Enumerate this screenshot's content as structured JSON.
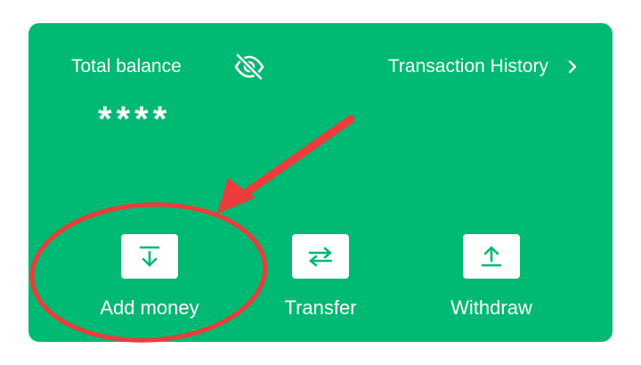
{
  "balance": {
    "label": "Total balance",
    "value": "****",
    "visibility_icon": "eye-off-icon"
  },
  "history": {
    "label": "Transaction History",
    "icon": "chevron-right-icon"
  },
  "actions": [
    {
      "label": "Add money",
      "icon": "download-icon"
    },
    {
      "label": "Transfer",
      "icon": "swap-arrows-icon"
    },
    {
      "label": "Withdraw",
      "icon": "upload-icon"
    }
  ],
  "colors": {
    "card_background": "#00b972",
    "text": "#ffffff",
    "icon_tile": "#ffffff",
    "annotation": "#ee3b3b"
  }
}
